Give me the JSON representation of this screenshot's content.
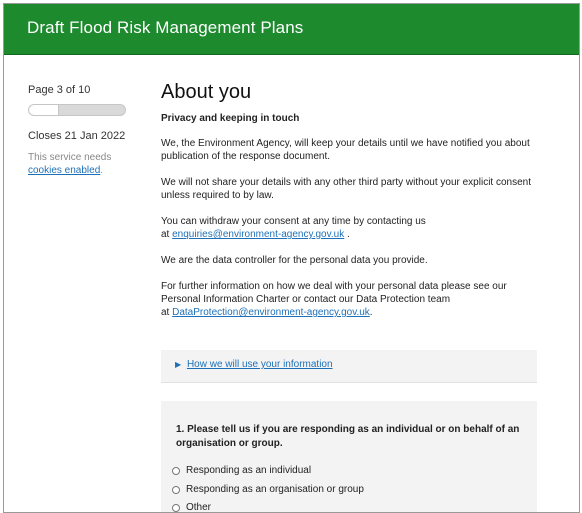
{
  "header": {
    "title": "Draft Flood Risk Management Plans"
  },
  "sidebar": {
    "page_count": "Page 3 of 10",
    "progress_fraction": 0.3,
    "closes": "Closes 21 Jan 2022",
    "cookie_note_prefix": "This service needs",
    "cookie_link": "cookies enabled",
    "cookie_note_suffix": "."
  },
  "main": {
    "title": "About you",
    "section_heading": "Privacy and keeping in touch",
    "para1": "We, the Environment Agency, will keep your details until we have notified you about publication of the response document.",
    "para2": "We will not share your details with any other third party without your explicit consent unless required to by law.",
    "para3_text": "You can withdraw your consent at any time by contacting us",
    "para3_at": "at",
    "para3_link": "enquiries@environment-agency.gov.uk",
    "para3_suffix": " .",
    "para4": "We are the data controller for the personal data you provide.",
    "para5_text": "For further information on how we deal with your personal data please see our Personal Information Charter or contact our Data Protection team",
    "para5_at": "at",
    "para5_link": "DataProtection@environment-agency.gov.uk",
    "para5_suffix": "."
  },
  "details": {
    "arrow_icon": "triangle-right-icon",
    "label": "How we will use your information"
  },
  "question": {
    "text": "1. Please tell us if you are responding as an individual or on behalf of an organisation or group.",
    "options": [
      "Responding as an individual",
      "Responding as an organisation or group",
      "Other"
    ]
  }
}
